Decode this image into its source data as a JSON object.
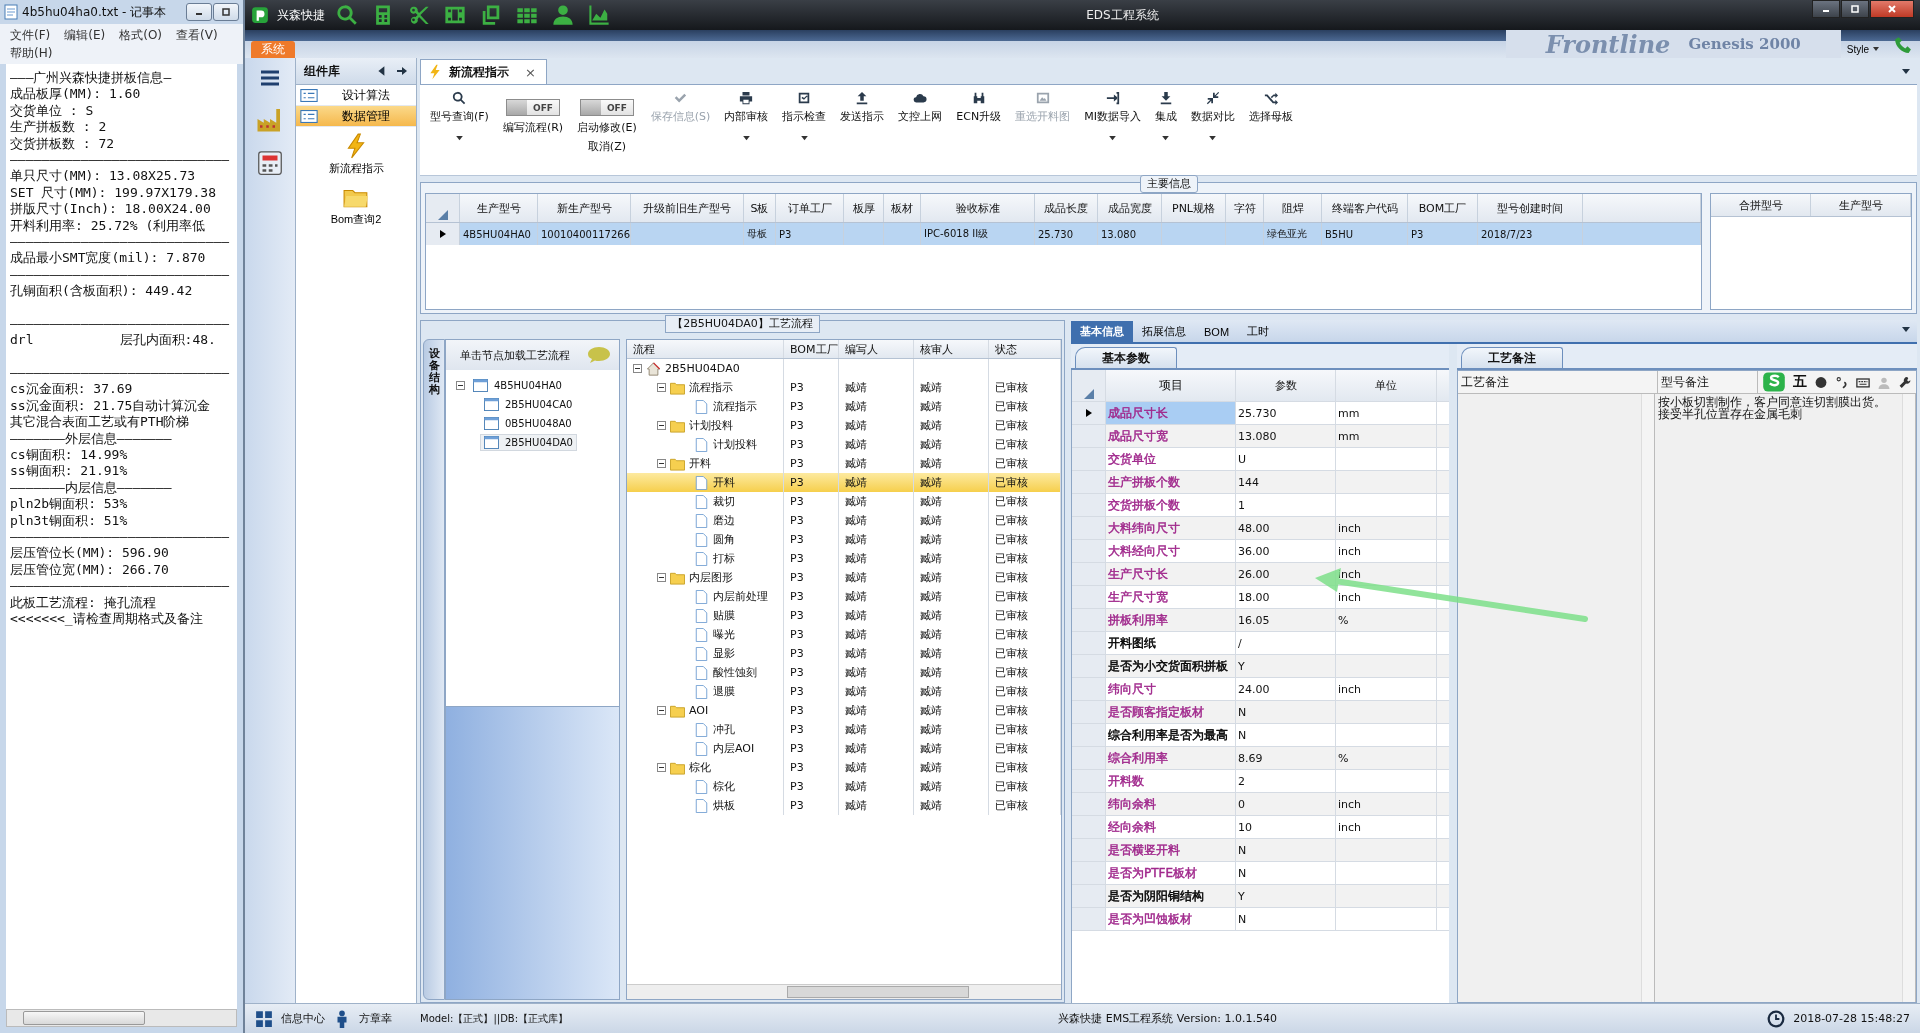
{
  "notepad": {
    "title": "4b5hu04ha0.txt - 记事本",
    "menu": [
      "文件(F)",
      "编辑(E)",
      "格式(O)",
      "查看(V)",
      "帮助(H)"
    ],
    "lines": [
      "———广州兴森快捷拼板信息—",
      "成品板厚(MM): 1.60",
      "交货单位 : S",
      "生产拼板数 : 2",
      "交货拼板数 : 72",
      "————————————————————————————",
      "单只尺寸(MM): 13.08X25.73",
      "SET 尺寸(MM): 199.97X179.38",
      "拼版尺寸(Inch): 18.00X24.00",
      "开料利用率: 25.72% (利用率低",
      "————————————————————————————",
      "成品最小SMT宽度(mil): 7.870",
      "————————————————————————————",
      "孔铜面积(含板面积): 449.42",
      {
        "text": "————————————————————————————",
        "blank_before": true
      },
      "drl           层孔内面积:48.",
      {
        "text": "————————————————————————————",
        "blank_before": true
      },
      "cs沉金面积: 37.69",
      "ss沉金面积: 21.75自动计算沉金",
      "其它混合表面工艺或有PTH阶梯",
      "———————外层信息———————",
      "cs铜面积: 14.99%",
      "ss铜面积: 21.91%",
      "———————内层信息———————",
      "pln2b铜面积: 53%",
      "pln3t铜面积: 51%",
      "————————————————————————————",
      "层压管位长(MM): 596.90",
      "层压管位宽(MM): 266.70",
      "————————————————————————————",
      "此板工艺流程: 掩孔流程",
      "<<<<<<<_请检查周期格式及备注"
    ]
  },
  "app": {
    "brand": "兴森快捷",
    "title": "EDS工程系统",
    "system_tab": "系统",
    "banner": [
      "Frontline",
      "Genesis 2000"
    ],
    "style_menu": "Style"
  },
  "components": {
    "title": "组件库",
    "items": [
      {
        "label": "设计算法",
        "selected": false
      },
      {
        "label": "数据管理",
        "selected": true
      }
    ],
    "launchers": [
      {
        "label": "新流程指示"
      },
      {
        "label": "Bom查询2"
      }
    ]
  },
  "doc_tab": {
    "label": "新流程指示",
    "close": "×"
  },
  "toolbar": [
    {
      "kind": "button",
      "label": "型号查询(F)",
      "disabled": false,
      "dropdown": true
    },
    {
      "kind": "toggle",
      "label": "编写流程(R)",
      "state_text": "OFF",
      "on": false
    },
    {
      "kind": "toggle",
      "label": "启动修改(E)",
      "sublabel": "取消(Z)",
      "state_text": "OFF",
      "on": false
    },
    {
      "kind": "button",
      "label": "保存信息(S)",
      "disabled": true,
      "dropdown": false
    },
    {
      "kind": "button",
      "label": "内部审核",
      "disabled": false,
      "dropdown": true
    },
    {
      "kind": "button",
      "label": "指示检查",
      "disabled": false,
      "dropdown": true
    },
    {
      "kind": "button",
      "label": "发送指示",
      "disabled": false,
      "dropdown": false
    },
    {
      "kind": "button",
      "label": "文控上网",
      "disabled": false,
      "dropdown": false
    },
    {
      "kind": "button",
      "label": "ECN升级",
      "disabled": false,
      "dropdown": false
    },
    {
      "kind": "button",
      "label": "重选开料图",
      "disabled": true,
      "dropdown": false
    },
    {
      "kind": "button",
      "label": "MI数据导入",
      "disabled": false,
      "dropdown": true
    },
    {
      "kind": "button",
      "label": "集成",
      "disabled": false,
      "dropdown": true
    },
    {
      "kind": "button",
      "label": "数据对比",
      "disabled": false,
      "dropdown": true
    },
    {
      "kind": "button",
      "label": "选择母板",
      "disabled": false,
      "dropdown": false
    }
  ],
  "main_info": {
    "title": "主要信息",
    "columns": [
      "生产型号",
      "新生产型号",
      "升级前旧生产型号",
      "S板",
      "订单工厂",
      "板厚",
      "板材",
      "验收标准",
      "成品长度",
      "成品宽度",
      "PNL规格",
      "字符",
      "阻焊",
      "终端客户代码",
      "BOM工厂",
      "型号创建时间"
    ],
    "rows": [
      {
        "selected": true,
        "cells": [
          "4B5HU04HA0",
          "10010400117266",
          null,
          "母板",
          "P3",
          null,
          null,
          "IPC-6018 II级",
          "25.730",
          "13.080",
          null,
          null,
          "绿色亚光",
          "B5HU",
          "P3",
          "2018/7/23"
        ]
      }
    ],
    "side_columns": [
      "合拼型号",
      "生产型号"
    ]
  },
  "process": {
    "title": "【2B5HU04DA0】工艺流程",
    "side_tab": "设备结构",
    "tree_hint": "单击节点加载工艺流程",
    "models": {
      "label": "4B5HU04HA0",
      "expanded": true,
      "selected": false,
      "children": [
        {
          "label": "2B5HU04CA0",
          "selected": false
        },
        {
          "label": "0B5HU048A0",
          "selected": false
        },
        {
          "label": "2B5HU04DA0",
          "selected": true
        }
      ]
    },
    "columns": [
      "流程",
      "BOM工厂",
      "编写人",
      "核审人",
      "状态"
    ],
    "flow": {
      "label": "2B5HU04DA0",
      "expanded": true,
      "selected": false,
      "children": [
        {
          "label": "流程指示",
          "factory": "P3",
          "writer": "臧靖",
          "reviewer": "臧靖",
          "status": "已审核",
          "expanded": true,
          "selected": false,
          "children": [
            {
              "label": "流程指示",
              "factory": "P3",
              "writer": "臧靖",
              "reviewer": "臧靖",
              "status": "已审核",
              "selected": false
            }
          ]
        },
        {
          "label": "计划投料",
          "factory": "P3",
          "writer": "臧靖",
          "reviewer": "臧靖",
          "status": "已审核",
          "expanded": true,
          "selected": false,
          "children": [
            {
              "label": "计划投料",
              "factory": "P3",
              "writer": "臧靖",
              "reviewer": "臧靖",
              "status": "已审核",
              "selected": false
            }
          ]
        },
        {
          "label": "开料",
          "factory": "P3",
          "writer": "臧靖",
          "reviewer": "臧靖",
          "status": "已审核",
          "expanded": true,
          "selected": false,
          "children": [
            {
              "label": "开料",
              "factory": "P3",
              "writer": "臧靖",
              "reviewer": "臧靖",
              "status": "已审核",
              "selected": true
            },
            {
              "label": "裁切",
              "factory": "P3",
              "writer": "臧靖",
              "reviewer": "臧靖",
              "status": "已审核",
              "selected": false
            },
            {
              "label": "磨边",
              "factory": "P3",
              "writer": "臧靖",
              "reviewer": "臧靖",
              "status": "已审核",
              "selected": false
            },
            {
              "label": "圆角",
              "factory": "P3",
              "writer": "臧靖",
              "reviewer": "臧靖",
              "status": "已审核",
              "selected": false
            },
            {
              "label": "打标",
              "factory": "P3",
              "writer": "臧靖",
              "reviewer": "臧靖",
              "status": "已审核",
              "selected": false
            }
          ]
        },
        {
          "label": "内层图形",
          "factory": "P3",
          "writer": "臧靖",
          "reviewer": "臧靖",
          "status": "已审核",
          "expanded": true,
          "selected": false,
          "children": [
            {
              "label": "内层前处理",
              "factory": "P3",
              "writer": "臧靖",
              "reviewer": "臧靖",
              "status": "已审核",
              "selected": false
            },
            {
              "label": "贴膜",
              "factory": "P3",
              "writer": "臧靖",
              "reviewer": "臧靖",
              "status": "已审核",
              "selected": false
            },
            {
              "label": "曝光",
              "factory": "P3",
              "writer": "臧靖",
              "reviewer": "臧靖",
              "status": "已审核",
              "selected": false
            },
            {
              "label": "显影",
              "factory": "P3",
              "writer": "臧靖",
              "reviewer": "臧靖",
              "status": "已审核",
              "selected": false
            },
            {
              "label": "酸性蚀刻",
              "factory": "P3",
              "writer": "臧靖",
              "reviewer": "臧靖",
              "status": "已审核",
              "selected": false
            },
            {
              "label": "退膜",
              "factory": "P3",
              "writer": "臧靖",
              "reviewer": "臧靖",
              "status": "已审核",
              "selected": false
            }
          ]
        },
        {
          "label": "AOI",
          "factory": "P3",
          "writer": "臧靖",
          "reviewer": "臧靖",
          "status": "已审核",
          "expanded": true,
          "selected": false,
          "children": [
            {
              "label": "冲孔",
              "factory": "P3",
              "writer": "臧靖",
              "reviewer": "臧靖",
              "status": "已审核",
              "selected": false
            },
            {
              "label": "内层AOI",
              "factory": "P3",
              "writer": "臧靖",
              "reviewer": "臧靖",
              "status": "已审核",
              "selected": false
            }
          ]
        },
        {
          "label": "棕化",
          "factory": "P3",
          "writer": "臧靖",
          "reviewer": "臧靖",
          "status": "已审核",
          "expanded": true,
          "selected": false,
          "children": [
            {
              "label": "棕化",
              "factory": "P3",
              "writer": "臧靖",
              "reviewer": "臧靖",
              "status": "已审核",
              "selected": false
            },
            {
              "label": "烘板",
              "factory": "P3",
              "writer": "臧靖",
              "reviewer": "臧靖",
              "status": "已审核",
              "selected": false
            }
          ]
        }
      ]
    }
  },
  "info": {
    "tabs": [
      {
        "label": "基本信息",
        "selected": true
      },
      {
        "label": "拓展信息",
        "selected": false
      },
      {
        "label": "BOM",
        "selected": false
      },
      {
        "label": "工时",
        "selected": false
      }
    ],
    "params_tab": "基本参数",
    "columns": [
      "项目",
      "参数",
      "单位"
    ],
    "rows": [
      {
        "item": "成品尺寸长",
        "value": "25.730",
        "unit": "mm",
        "color": "#a0288c",
        "selected": true
      },
      {
        "item": "成品尺寸宽",
        "value": "13.080",
        "unit": "mm",
        "color": "#a0288c",
        "selected": false
      },
      {
        "item": "交货单位",
        "value": "U",
        "color": "#a0288c",
        "selected": false
      },
      {
        "item": "生产拼板个数",
        "value": "144",
        "color": "#a0288c",
        "selected": false
      },
      {
        "item": "交货拼板个数",
        "value": "1",
        "color": "#a0288c",
        "selected": false
      },
      {
        "item": "大料纬向尺寸",
        "value": "48.00",
        "unit": "inch",
        "color": "#a0288c",
        "selected": false
      },
      {
        "item": "大料经向尺寸",
        "value": "36.00",
        "unit": "inch",
        "color": "#a0288c",
        "selected": false
      },
      {
        "item": "生产尺寸长",
        "value": "26.00",
        "unit": "inch",
        "color": "#a0288c",
        "selected": false
      },
      {
        "item": "生产尺寸宽",
        "value": "18.00",
        "unit": "inch",
        "color": "#a0288c",
        "selected": false
      },
      {
        "item": "拼板利用率",
        "value": "16.05",
        "unit": "%",
        "color": "#a0288c",
        "selected": false
      },
      {
        "item": "开料图纸",
        "value": "/",
        "color": "#000000",
        "selected": false
      },
      {
        "item": "是否为小交货面积拼板",
        "value": "Y",
        "color": "#000000",
        "selected": false
      },
      {
        "item": "纬向尺寸",
        "value": "24.00",
        "unit": "inch",
        "color": "#a0288c",
        "selected": false
      },
      {
        "item": "是否顾客指定板材",
        "value": "N",
        "color": "#a0288c",
        "selected": false
      },
      {
        "item": "综合利用率是否为最高",
        "value": "N",
        "color": "#000000",
        "selected": false
      },
      {
        "item": "综合利用率",
        "value": "8.69",
        "unit": "%",
        "color": "#a0288c",
        "selected": false
      },
      {
        "item": "开料数",
        "value": "2",
        "color": "#a0288c",
        "selected": false
      },
      {
        "item": "纬向余料",
        "value": "0",
        "unit": "inch",
        "color": "#a0288c",
        "selected": false
      },
      {
        "item": "经向余料",
        "value": "10",
        "unit": "inch",
        "color": "#a0288c",
        "selected": false
      },
      {
        "item": "是否横竖开料",
        "value": "N",
        "color": "#a0288c",
        "selected": false
      },
      {
        "item": "是否为PTFE板材",
        "value": "N",
        "color": "#a0288c",
        "selected": false
      },
      {
        "item": "是否为阴阳铜结构",
        "value": "Y",
        "color": "#000000",
        "selected": false
      },
      {
        "item": "是否为凹蚀板材",
        "value": "N",
        "color": "#a0288c",
        "selected": false
      }
    ],
    "notes_tab": "工艺备注",
    "notes_columns": [
      "工艺备注",
      "型号备注"
    ],
    "model_note": [
      "按小板切割制作，客户同意连切割膜出货。",
      "接受半孔位置存在金属毛刺"
    ]
  },
  "ime": {
    "mode": "五"
  },
  "status": {
    "info_center": "信息中心",
    "user": "方章幸",
    "model": "Model:【正式】||DB:【正式库】",
    "version": "兴森快捷 EMS工程系统 Version: 1.0.1.540",
    "time": "2018-07-28 15:48:27"
  }
}
